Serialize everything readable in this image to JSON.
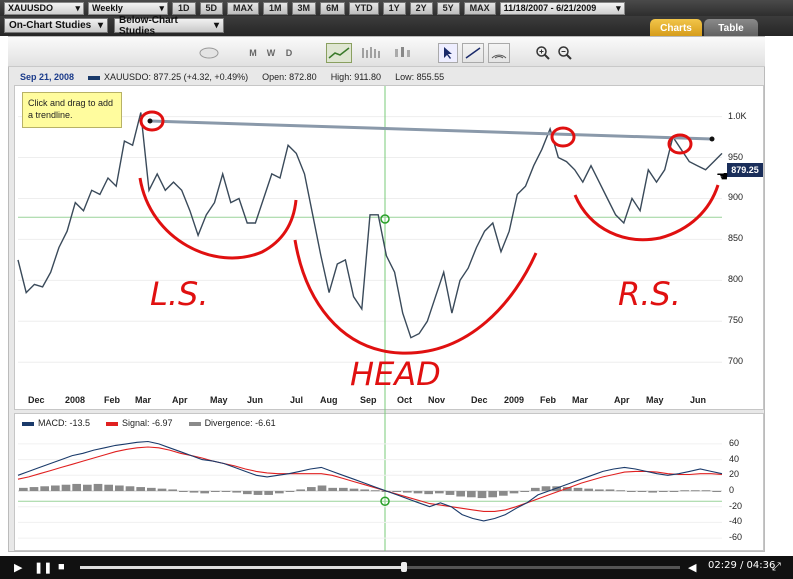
{
  "toolbar": {
    "symbol": "XAUUSDO",
    "interval": "Weekly",
    "ranges": [
      "1D",
      "5D",
      "MAX",
      "1M",
      "3M",
      "6M",
      "YTD",
      "1Y",
      "2Y",
      "5Y",
      "MAX"
    ],
    "date_range": "11/18/2007 - 6/21/2009"
  },
  "studies": {
    "on_chart": "On-Chart Studies",
    "below_chart": "Below-Chart Studies"
  },
  "tabs": {
    "charts": "Charts",
    "table": "Table"
  },
  "tools": [
    "M",
    "W",
    "D"
  ],
  "info": {
    "date": "Sep 21, 2008",
    "quote": "XAUUSDO: 877.25 (+4.32, +0.49%)",
    "open": "Open: 872.80",
    "high": "High: 911.80",
    "low": "Low: 855.55",
    "series_color": "#1a3a6a"
  },
  "tooltip": {
    "text": "Click and drag to add a trendline."
  },
  "price_tag": "879.25",
  "chart_data": [
    {
      "type": "line",
      "x_ticks": [
        "Dec",
        "2008",
        "Feb",
        "Mar",
        "Apr",
        "May",
        "Jun",
        "Jul",
        "Aug",
        "Sep",
        "Oct",
        "Nov",
        "Dec",
        "2009",
        "Feb",
        "Mar",
        "Apr",
        "May",
        "Jun"
      ],
      "y_ticks": [
        "1.0K",
        "950",
        "900",
        "850",
        "800",
        "750",
        "700"
      ],
      "ylim": [
        660,
        1030
      ],
      "series": [
        {
          "name": "XAUUSDO",
          "color": "#3a4a5a",
          "values": [
            825,
            785,
            795,
            792,
            810,
            840,
            860,
            895,
            885,
            910,
            905,
            925,
            915,
            970,
            965,
            1005,
            910,
            930,
            910,
            920,
            910,
            885,
            855,
            880,
            895,
            930,
            895,
            900,
            870,
            870,
            900,
            930,
            925,
            965,
            955,
            930,
            880,
            830,
            785,
            820,
            825,
            780,
            765,
            880,
            880,
            830,
            810,
            760,
            730,
            735,
            750,
            780,
            810,
            760,
            800,
            815,
            840,
            860,
            870,
            835,
            860,
            905,
            915,
            940,
            960,
            985,
            950,
            945,
            935,
            920,
            940,
            920,
            900,
            880,
            870,
            900,
            885,
            935,
            920,
            935,
            975,
            960,
            945,
            940,
            935,
            945,
            955
          ]
        }
      ],
      "annotations": [
        "L.S.",
        "HEAD",
        "R.S."
      ]
    },
    {
      "type": "line",
      "legend": [
        "MACD: -13.5",
        "Signal: -6.97",
        "Divergence: -6.61"
      ],
      "y_ticks": [
        "60",
        "40",
        "20",
        "0",
        "-20",
        "-40",
        "-60"
      ],
      "ylim": [
        -70,
        70
      ],
      "series": [
        {
          "name": "MACD",
          "color": "#1a3a6a",
          "values": [
            20,
            25,
            30,
            35,
            40,
            45,
            48,
            52,
            55,
            58,
            60,
            62,
            63,
            60,
            55,
            50,
            45,
            40,
            38,
            35,
            30,
            25,
            20,
            18,
            20,
            22,
            25,
            28,
            30,
            25,
            20,
            15,
            10,
            5,
            0,
            -5,
            -10,
            -15,
            -20,
            -15,
            -20,
            -30,
            -35,
            -38,
            -35,
            -30,
            -22,
            -15,
            -5,
            0,
            5,
            10,
            15,
            20,
            25,
            28,
            30,
            28,
            25,
            22,
            20,
            22,
            25,
            28,
            25,
            22
          ]
        },
        {
          "name": "Signal",
          "color": "#e02020",
          "values": [
            15,
            18,
            22,
            26,
            30,
            34,
            38,
            42,
            46,
            50,
            53,
            55,
            56,
            55,
            52,
            48,
            45,
            42,
            38,
            35,
            32,
            28,
            25,
            23,
            22,
            22,
            22,
            22,
            22,
            20,
            16,
            12,
            8,
            4,
            0,
            -4,
            -8,
            -12,
            -16,
            -18,
            -20,
            -22,
            -24,
            -26,
            -26,
            -24,
            -20,
            -15,
            -10,
            -5,
            0,
            5,
            10,
            14,
            18,
            21,
            24,
            25,
            25,
            24,
            22,
            21,
            21,
            22,
            22,
            21
          ]
        },
        {
          "name": "Divergence",
          "color": "#8a8a8a",
          "values": [
            4,
            5,
            6,
            7,
            8,
            9,
            8,
            9,
            8,
            7,
            6,
            5,
            4,
            3,
            2,
            0,
            -2,
            -3,
            -1,
            0,
            -2,
            -4,
            -5,
            -5,
            -3,
            -1,
            2,
            5,
            7,
            4,
            4,
            3,
            2,
            1,
            0,
            -1,
            -2,
            -3,
            -4,
            -3,
            -5,
            -7,
            -8,
            -9,
            -8,
            -6,
            -3,
            0,
            4,
            6,
            6,
            5,
            4,
            3,
            2,
            2,
            1,
            0,
            -1,
            -2,
            -1,
            0,
            1,
            1,
            1,
            0
          ]
        }
      ]
    }
  ],
  "player": {
    "time": "02:29 / 04:36",
    "progress": 0.54
  }
}
